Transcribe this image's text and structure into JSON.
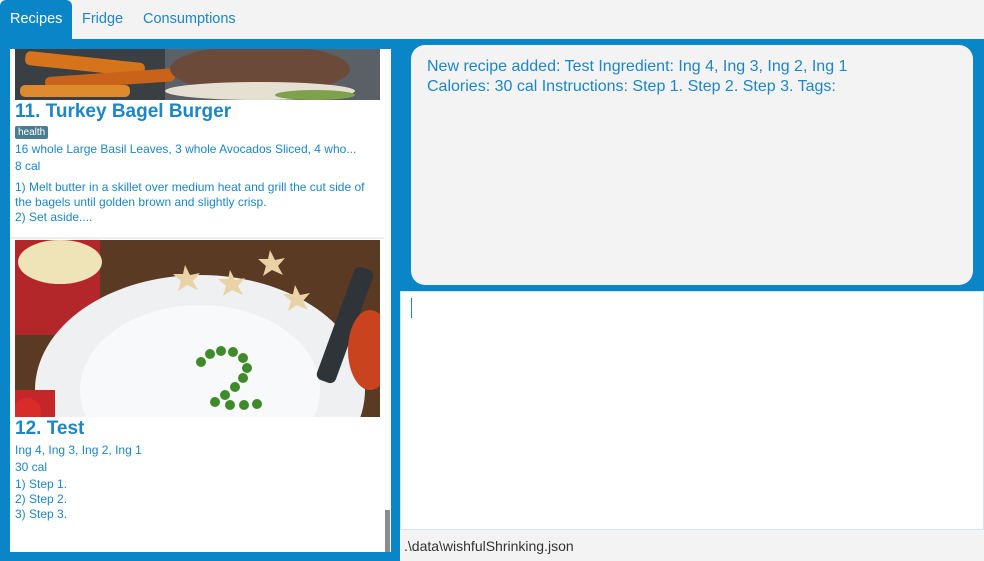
{
  "tabs": {
    "recipes": "Recipes",
    "fridge": "Fridge",
    "consumptions": "Consumptions"
  },
  "recipes": [
    {
      "title": "11.  Turkey Bagel Burger",
      "tag": "health",
      "ingredients": "16 whole Large Basil Leaves, 3 whole Avocados Sliced, 4 who...",
      "calories": "8 cal",
      "instructions": "1) Melt butter in a skillet over medium heat and grill the cut side of the bagels until golden brown and slightly crisp.\n2) Set aside...."
    },
    {
      "title": "12.  Test",
      "ingredients": " Ing 4,  Ing 3,  Ing 2,  Ing 1",
      "calories": "30 cal",
      "instructions": "1) Step 1.\n2) Step 2.\n3) Step 3."
    }
  ],
  "result": {
    "line1": "New recipe added: Test Ingredient:  Ing 4,  Ing 3,  Ing 2,  Ing 1",
    "line2": "Calories: 30 cal Instructions: Step 1.  Step 2.  Step 3. Tags:"
  },
  "status": {
    "path": ".\\data\\wishfulShrinking.json"
  },
  "colors": {
    "accent": "#0a86c8",
    "text_blue": "#1c86c8",
    "panel_gray": "#f3f3f3"
  }
}
